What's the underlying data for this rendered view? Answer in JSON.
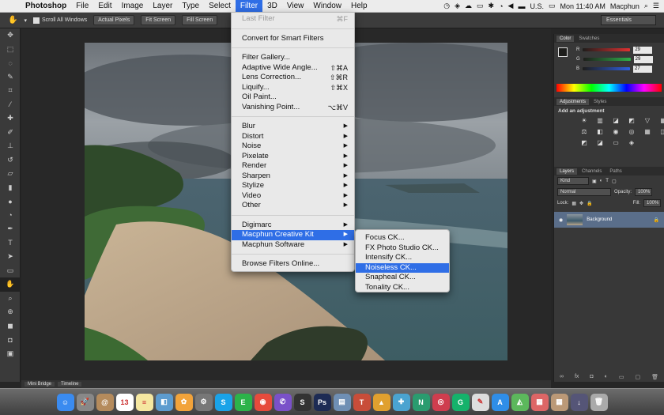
{
  "menubar": {
    "apple": "",
    "items": [
      {
        "label": "Photoshop",
        "name": "menu-photoshop"
      },
      {
        "label": "File",
        "name": "menu-file"
      },
      {
        "label": "Edit",
        "name": "menu-edit"
      },
      {
        "label": "Image",
        "name": "menu-image"
      },
      {
        "label": "Layer",
        "name": "menu-layer"
      },
      {
        "label": "Type",
        "name": "menu-type"
      },
      {
        "label": "Select",
        "name": "menu-select"
      },
      {
        "label": "Filter",
        "name": "menu-filter"
      },
      {
        "label": "3D",
        "name": "menu-3d"
      },
      {
        "label": "View",
        "name": "menu-view"
      },
      {
        "label": "Window",
        "name": "menu-window"
      },
      {
        "label": "Help",
        "name": "menu-help"
      }
    ],
    "locale": "U.S.",
    "datetime": "Mon 11:40 AM",
    "user": "Macphun"
  },
  "optionsbar": {
    "scroll_all": "Scroll All Windows",
    "actual_pixels": "Actual Pixels",
    "fit_screen": "Fit Screen",
    "fill_screen": "Fill Screen",
    "workspace": "Essentials"
  },
  "filter_menu": {
    "last_filter": "Last Filter",
    "last_filter_sc": "⌘F",
    "smart": "Convert for Smart Filters",
    "group1": [
      {
        "label": "Filter Gallery...",
        "sc": ""
      },
      {
        "label": "Adaptive Wide Angle...",
        "sc": "⇧⌘A"
      },
      {
        "label": "Lens Correction...",
        "sc": "⇧⌘R"
      },
      {
        "label": "Liquify...",
        "sc": "⇧⌘X"
      },
      {
        "label": "Oil Paint...",
        "sc": ""
      },
      {
        "label": "Vanishing Point...",
        "sc": "⌥⌘V"
      }
    ],
    "group2": [
      "Blur",
      "Distort",
      "Noise",
      "Pixelate",
      "Render",
      "Sharpen",
      "Stylize",
      "Video",
      "Other"
    ],
    "group3": [
      "Digimarc",
      "Macphun Creative Kit",
      "Macphun Software"
    ],
    "browse": "Browse Filters Online..."
  },
  "submenu": [
    "Focus CK...",
    "FX Photo Studio CK...",
    "Intensify CK...",
    "Noiseless CK...",
    "Snapheal CK...",
    "Tonality CK..."
  ],
  "panels": {
    "color_tabs": [
      "Color",
      "Swatches"
    ],
    "rgb": [
      {
        "ch": "R",
        "val": "29",
        "color": "#e03131"
      },
      {
        "ch": "G",
        "val": "29",
        "color": "#2fb14a"
      },
      {
        "ch": "B",
        "val": "27",
        "color": "#2f5fe0"
      }
    ],
    "adj_tabs": [
      "Adjustments",
      "Styles"
    ],
    "add_adjustment": "Add an adjustment",
    "layer_tabs": [
      "Layers",
      "Channels",
      "Paths"
    ],
    "kind": "Kind",
    "blend": "Normal",
    "opacity_label": "Opacity:",
    "opacity": "100%",
    "lock": "Lock:",
    "fill_label": "Fill:",
    "fill": "100%",
    "layer_name": "Background"
  },
  "bottom_tabs": [
    "Mini Bridge",
    "Timeline"
  ],
  "dock": [
    {
      "n": "finder",
      "c": "#3a8bf0",
      "g": "☺"
    },
    {
      "n": "launchpad",
      "c": "#888",
      "g": "🚀"
    },
    {
      "n": "contacts",
      "c": "#b58b5c",
      "g": "@"
    },
    {
      "n": "calendar",
      "c": "#fff",
      "g": "13"
    },
    {
      "n": "notes",
      "c": "#f5e7a0",
      "g": "≡"
    },
    {
      "n": "preview",
      "c": "#5d9ccf",
      "g": "◧"
    },
    {
      "n": "photos",
      "c": "#f2a33a",
      "g": "✿"
    },
    {
      "n": "system-preferences",
      "c": "#777",
      "g": "⚙"
    },
    {
      "n": "skype",
      "c": "#1aa3e8",
      "g": "S"
    },
    {
      "n": "evernote",
      "c": "#2cb34a",
      "g": "E"
    },
    {
      "n": "chrome",
      "c": "#e64b3c",
      "g": "◉"
    },
    {
      "n": "viber",
      "c": "#7a51c9",
      "g": "✆"
    },
    {
      "n": "sublime",
      "c": "#333",
      "g": "S"
    },
    {
      "n": "photoshop",
      "c": "#1d2b54",
      "g": "Ps"
    },
    {
      "n": "image-capture",
      "c": "#6f8fb4",
      "g": "▤"
    },
    {
      "n": "tonality",
      "c": "#c84d39",
      "g": "T"
    },
    {
      "n": "intensify",
      "c": "#e0a02f",
      "g": "▲"
    },
    {
      "n": "snapheal",
      "c": "#4aa3d0",
      "g": "✚"
    },
    {
      "n": "noiseless",
      "c": "#2a9c6f",
      "g": "N"
    },
    {
      "n": "focus",
      "c": "#cf3d4e",
      "g": "◎"
    },
    {
      "n": "grammarly",
      "c": "#15b26b",
      "g": "G"
    },
    {
      "n": "script-editor",
      "c": "#ddd",
      "g": "✎"
    },
    {
      "n": "app-store",
      "c": "#2f8ee8",
      "g": "A"
    },
    {
      "n": "maps",
      "c": "#5cb85c",
      "g": "◭"
    },
    {
      "n": "document-1",
      "c": "#d66",
      "g": "▦"
    },
    {
      "n": "document-2",
      "c": "#b97",
      "g": "▦"
    },
    {
      "n": "downloads",
      "c": "#557",
      "g": "↓"
    },
    {
      "n": "trash",
      "c": "#aaa",
      "g": "🗑"
    }
  ]
}
